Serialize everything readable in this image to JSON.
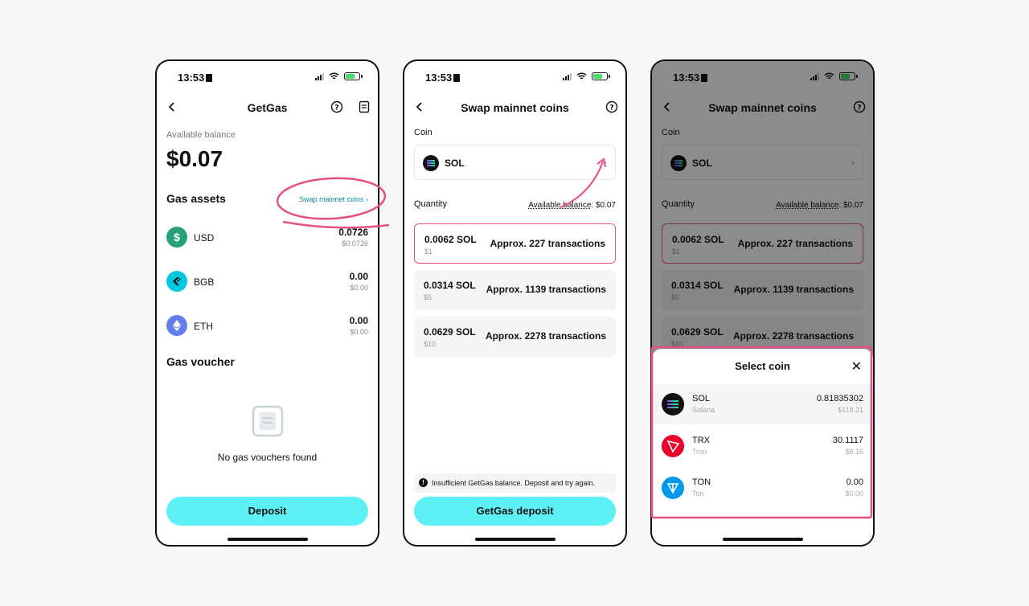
{
  "status": {
    "time": "13:53"
  },
  "screen1": {
    "title": "GetGas",
    "balance_label": "Available balance",
    "balance": "$0.07",
    "assets_title": "Gas assets",
    "swap_link": "Swap mainnet coins",
    "assets": [
      {
        "name": "USD",
        "amount": "0.0726",
        "usd": "$0.0726",
        "color": "#26a17b"
      },
      {
        "name": "BGB",
        "amount": "0.00",
        "usd": "$0.00",
        "color": "#00c8e0"
      },
      {
        "name": "ETH",
        "amount": "0.00",
        "usd": "$0.00",
        "color": "#627eea"
      }
    ],
    "voucher_title": "Gas voucher",
    "empty_text": "No gas vouchers found",
    "deposit_button": "Deposit"
  },
  "screen2": {
    "title": "Swap mainnet coins",
    "coin_label": "Coin",
    "coin": "SOL",
    "quantity_label": "Quantity",
    "available_label": "Available balance",
    "available_value": ": $0.07",
    "options": [
      {
        "qty": "0.0062 SOL",
        "usd": "$1",
        "tx": "Approx. 227 transactions"
      },
      {
        "qty": "0.0314 SOL",
        "usd": "$5",
        "tx": "Approx. 1139 transactions"
      },
      {
        "qty": "0.0629 SOL",
        "usd": "$10",
        "tx": "Approx. 2278 transactions"
      }
    ],
    "notice": "Insufficient GetGas balance. Deposit and try again.",
    "deposit_button": "GetGas deposit"
  },
  "screen3": {
    "sheet_title": "Select coin",
    "coins": [
      {
        "symbol": "SOL",
        "name": "Solana",
        "amount": "0.81835302",
        "usd": "$118.21"
      },
      {
        "symbol": "TRX",
        "name": "Tron",
        "amount": "30.1117",
        "usd": "$8.16"
      },
      {
        "symbol": "TON",
        "name": "Ton",
        "amount": "0.00",
        "usd": "$0.00"
      }
    ]
  },
  "colors": {
    "accent": "#5df0f5",
    "highlight": "#e84d86",
    "tron": "#eb0029",
    "ton": "#0098ea"
  }
}
